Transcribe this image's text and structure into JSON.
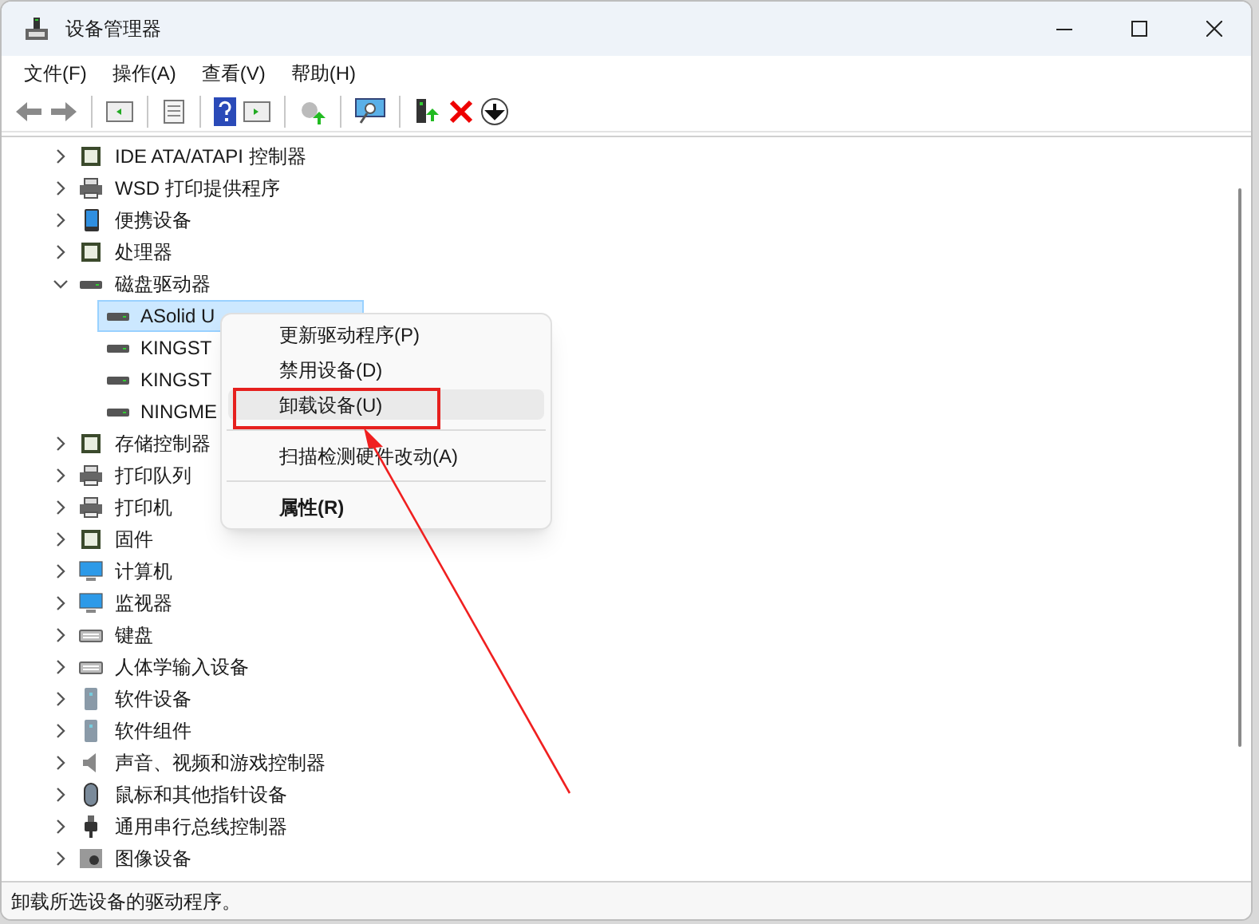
{
  "window": {
    "title": "设备管理器"
  },
  "menu_bar": [
    "文件(F)",
    "操作(A)",
    "查看(V)",
    "帮助(H)"
  ],
  "tree": [
    {
      "label": "IDE ATA/ATAPI 控制器",
      "expanded": false
    },
    {
      "label": "WSD 打印提供程序",
      "expanded": false
    },
    {
      "label": "便携设备",
      "expanded": false
    },
    {
      "label": "处理器",
      "expanded": false
    },
    {
      "label": "磁盘驱动器",
      "expanded": true,
      "children": [
        {
          "label": "ASolid U",
          "selected": true
        },
        {
          "label": "KINGST",
          "selected": false
        },
        {
          "label": "KINGST",
          "selected": false
        },
        {
          "label": "NINGME",
          "selected": false
        }
      ]
    },
    {
      "label": "存储控制器",
      "expanded": false
    },
    {
      "label": "打印队列",
      "expanded": false
    },
    {
      "label": "打印机",
      "expanded": false
    },
    {
      "label": "固件",
      "expanded": false
    },
    {
      "label": "计算机",
      "expanded": false
    },
    {
      "label": "监视器",
      "expanded": false
    },
    {
      "label": "键盘",
      "expanded": false
    },
    {
      "label": "人体学输入设备",
      "expanded": false
    },
    {
      "label": "软件设备",
      "expanded": false
    },
    {
      "label": "软件组件",
      "expanded": false
    },
    {
      "label": "声音、视频和游戏控制器",
      "expanded": false
    },
    {
      "label": "鼠标和其他指针设备",
      "expanded": false
    },
    {
      "label": "通用串行总线控制器",
      "expanded": false
    },
    {
      "label": "图像设备",
      "expanded": false
    }
  ],
  "context_menu": [
    {
      "kind": "item",
      "label": "更新驱动程序(P)",
      "selected": false,
      "default": false
    },
    {
      "kind": "item",
      "label": "禁用设备(D)",
      "selected": false,
      "default": false
    },
    {
      "kind": "item",
      "label": "卸载设备(U)",
      "selected": true,
      "default": false
    },
    {
      "kind": "separator"
    },
    {
      "kind": "item",
      "label": "扫描检测硬件改动(A)",
      "selected": false,
      "default": false
    },
    {
      "kind": "separator"
    },
    {
      "kind": "item",
      "label": "属性(R)",
      "selected": false,
      "default": true
    }
  ],
  "status_bar": "卸载所选设备的驱动程序。"
}
